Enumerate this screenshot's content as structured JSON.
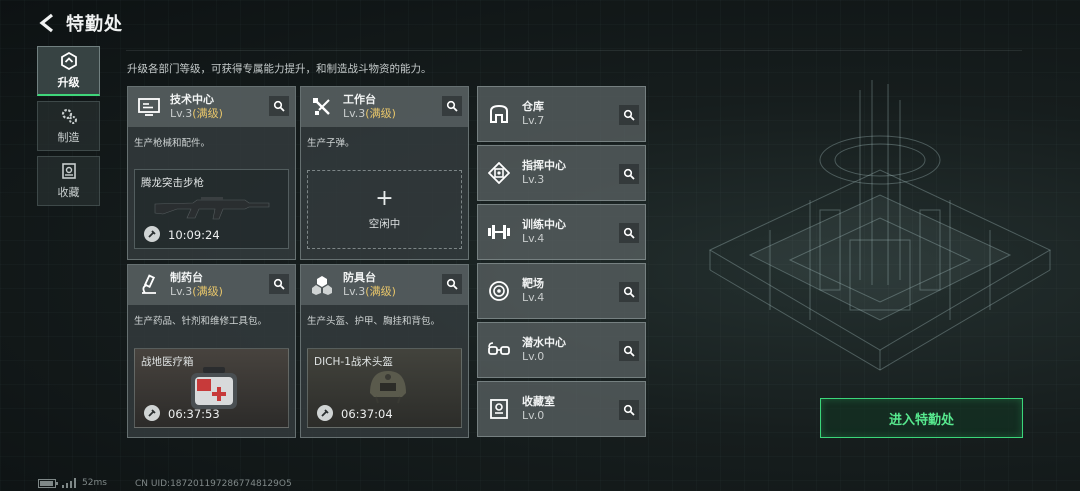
{
  "header": {
    "title": "特勤处"
  },
  "subtitle": "升级各部门等级，可获得专属能力提升，和制造战斗物资的能力。",
  "nav": [
    {
      "label": "升级",
      "icon": "upgrade-icon",
      "active": true
    },
    {
      "label": "制造",
      "icon": "gear-icon",
      "active": false
    },
    {
      "label": "收藏",
      "icon": "collection-icon",
      "active": false
    }
  ],
  "cards": {
    "tech": {
      "name": "技术中心",
      "level": "Lv.3",
      "full": "(满级)",
      "desc": "生产枪械和配件。",
      "slot_name": "腾龙突击步枪",
      "slot_time": "10:09:24"
    },
    "workbench": {
      "name": "工作台",
      "level": "Lv.3",
      "full": "(满级)",
      "desc": "生产子弹。",
      "idle_plus": "+",
      "idle_text": "空闲中"
    },
    "pharmacy": {
      "name": "制药台",
      "level": "Lv.3",
      "full": "(满级)",
      "desc": "生产药品、针剂和维修工具包。",
      "slot_name": "战地医疗箱",
      "slot_time": "06:37:53"
    },
    "armor": {
      "name": "防具台",
      "level": "Lv.3",
      "full": "(满级)",
      "desc": "生产头盔、护甲、胸挂和背包。",
      "slot_name": "DICH-1战术头盔",
      "slot_time": "06:37:04"
    }
  },
  "facilities": [
    {
      "name": "仓库",
      "level": "Lv.7",
      "icon": "warehouse-icon"
    },
    {
      "name": "指挥中心",
      "level": "Lv.3",
      "icon": "command-icon"
    },
    {
      "name": "训练中心",
      "level": "Lv.4",
      "icon": "dumbbell-icon"
    },
    {
      "name": "靶场",
      "level": "Lv.4",
      "icon": "target-icon"
    },
    {
      "name": "潜水中心",
      "level": "Lv.0",
      "icon": "diving-icon"
    },
    {
      "name": "收藏室",
      "level": "Lv.0",
      "icon": "collection-room-icon"
    }
  ],
  "enter_button": "进入特勤处",
  "footer": {
    "ping": "52ms",
    "uid": "CN UID:1872011972867748129O5"
  },
  "colors": {
    "accent_green": "#3bd67a",
    "full_level": "#e8c66a"
  }
}
